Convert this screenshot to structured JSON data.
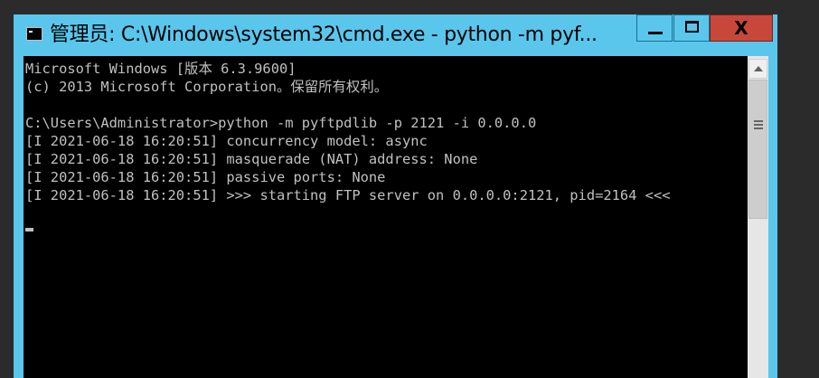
{
  "window": {
    "title": "管理员: C:\\Windows\\system32\\cmd.exe - python  -m pyf...",
    "close_glyph": "X"
  },
  "console": {
    "lines": [
      "Microsoft Windows [版本 6.3.9600]",
      "(c) 2013 Microsoft Corporation。保留所有权利。",
      "",
      "C:\\Users\\Administrator>python -m pyftpdlib -p 2121 -i 0.0.0.0",
      "[I 2021-06-18 16:20:51] concurrency model: async",
      "[I 2021-06-18 16:20:51] masquerade (NAT) address: None",
      "[I 2021-06-18 16:20:51] passive ports: None",
      "[I 2021-06-18 16:20:51] >>> starting FTP server on 0.0.0.0:2121, pid=2164 <<<"
    ]
  },
  "icons": {
    "app": "console-icon",
    "minimize": "minimize-icon",
    "maximize": "maximize-icon",
    "close": "close-icon",
    "scroll_up": "chevron-up-icon"
  },
  "colors": {
    "titlebar": "#5ac6ec",
    "close_button": "#c7483b",
    "console_bg": "#000000",
    "console_text": "#c0c0c0"
  }
}
